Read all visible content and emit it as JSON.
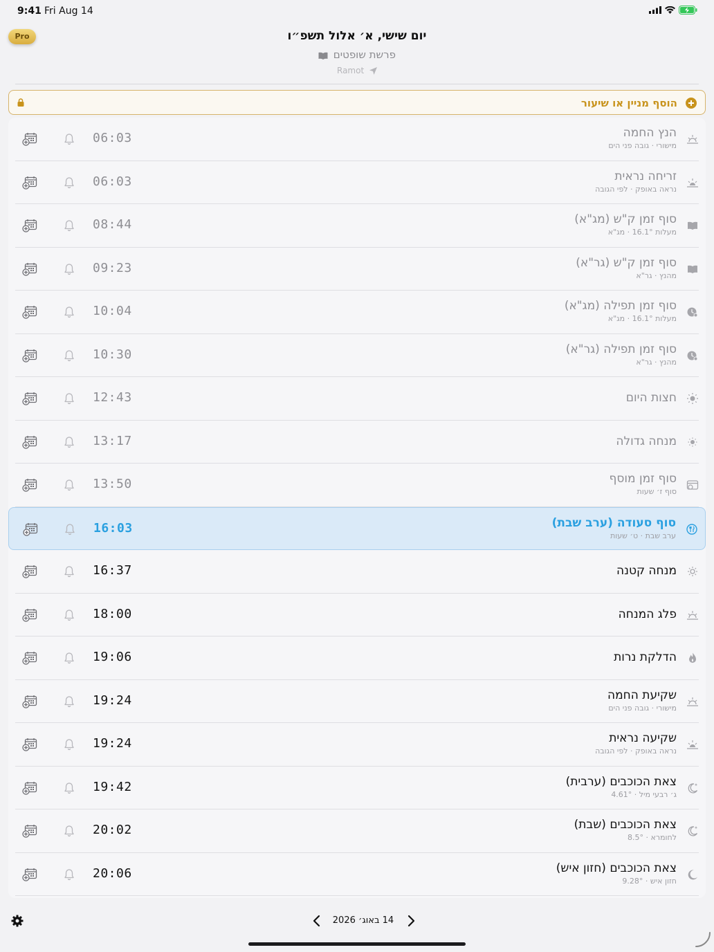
{
  "status_bar": {
    "time": "9:41",
    "date": "Fri Aug 14"
  },
  "header": {
    "pro_label": "Pro",
    "title": "יום שישי, א׳ אלול תשפ״ו",
    "parsha": "פרשת שופטים",
    "location": "Ramot"
  },
  "add_bar": {
    "label": "הוסף מניין או שיעור"
  },
  "colors": {
    "accent_gold": "#c8931c",
    "highlight_blue": "#2aa0e0",
    "highlight_bg": "#daeaf8"
  },
  "zmanim": [
    {
      "name": "הנץ החמה",
      "sub": "מישורי · גובה פני הים",
      "time": "06:03",
      "icon": "sunrise-icon",
      "state": "past"
    },
    {
      "name": "זריחה נראית",
      "sub": "נראה באופק · לפי הגובה",
      "time": "06:03",
      "icon": "sunrise-visible-icon",
      "state": "past"
    },
    {
      "name": "סוף זמן ק\"ש (מג\"א)",
      "sub": "מעלות 16.1° · מג\"א",
      "time": "08:44",
      "icon": "book-icon",
      "state": "past"
    },
    {
      "name": "סוף זמן ק\"ש (גר\"א)",
      "sub": "מהנץ · גר\"א",
      "time": "09:23",
      "icon": "book-icon",
      "state": "past"
    },
    {
      "name": "סוף זמן תפילה (מג\"א)",
      "sub": "מעלות 16.1° · מג\"א",
      "time": "10:04",
      "icon": "prayer-clock-icon",
      "state": "past"
    },
    {
      "name": "סוף זמן תפילה (גר\"א)",
      "sub": "מהנץ · גר\"א",
      "time": "10:30",
      "icon": "prayer-clock-icon",
      "state": "past"
    },
    {
      "name": "חצות היום",
      "sub": "",
      "time": "12:43",
      "icon": "sun-icon",
      "state": "past"
    },
    {
      "name": "מנחה גדולה",
      "sub": "",
      "time": "13:17",
      "icon": "sun-small-icon",
      "state": "past"
    },
    {
      "name": "סוף זמן מוסף",
      "sub": "סוף ז׳ שעות",
      "time": "13:50",
      "icon": "calendar-clock-icon",
      "state": "past"
    },
    {
      "name": "סוף סעודה (ערב שבת)",
      "sub": "ערב שבת · ט׳ שעות",
      "time": "16:03",
      "icon": "meal-icon",
      "state": "highlight"
    },
    {
      "name": "מנחה קטנה",
      "sub": "",
      "time": "16:37",
      "icon": "sun-outline-icon",
      "state": "current"
    },
    {
      "name": "פלג המנחה",
      "sub": "",
      "time": "18:00",
      "icon": "sunset-half-icon",
      "state": "current"
    },
    {
      "name": "הדלקת נרות",
      "sub": "",
      "time": "19:06",
      "icon": "flame-icon",
      "state": "current"
    },
    {
      "name": "שקיעת החמה",
      "sub": "מישורי · גובה פני הים",
      "time": "19:24",
      "icon": "sunset-icon",
      "state": "current"
    },
    {
      "name": "שקיעה נראית",
      "sub": "נראה באופק · לפי הגובה",
      "time": "19:24",
      "icon": "sunset-visible-icon",
      "state": "current"
    },
    {
      "name": "צאת הכוכבים (ערבית)",
      "sub": "ג׳ רבעי מיל · 4.61°",
      "time": "19:42",
      "icon": "moon-star-icon",
      "state": "current"
    },
    {
      "name": "צאת הכוכבים (שבת)",
      "sub": "לחומרא · 8.5°",
      "time": "20:02",
      "icon": "moon-star-icon",
      "state": "current"
    },
    {
      "name": "צאת הכוכבים (חזון איש)",
      "sub": "חזון איש · 9.28°",
      "time": "20:06",
      "icon": "moon-icon",
      "state": "current"
    }
  ],
  "footer": {
    "date": "14 באוג׳ 2026"
  }
}
